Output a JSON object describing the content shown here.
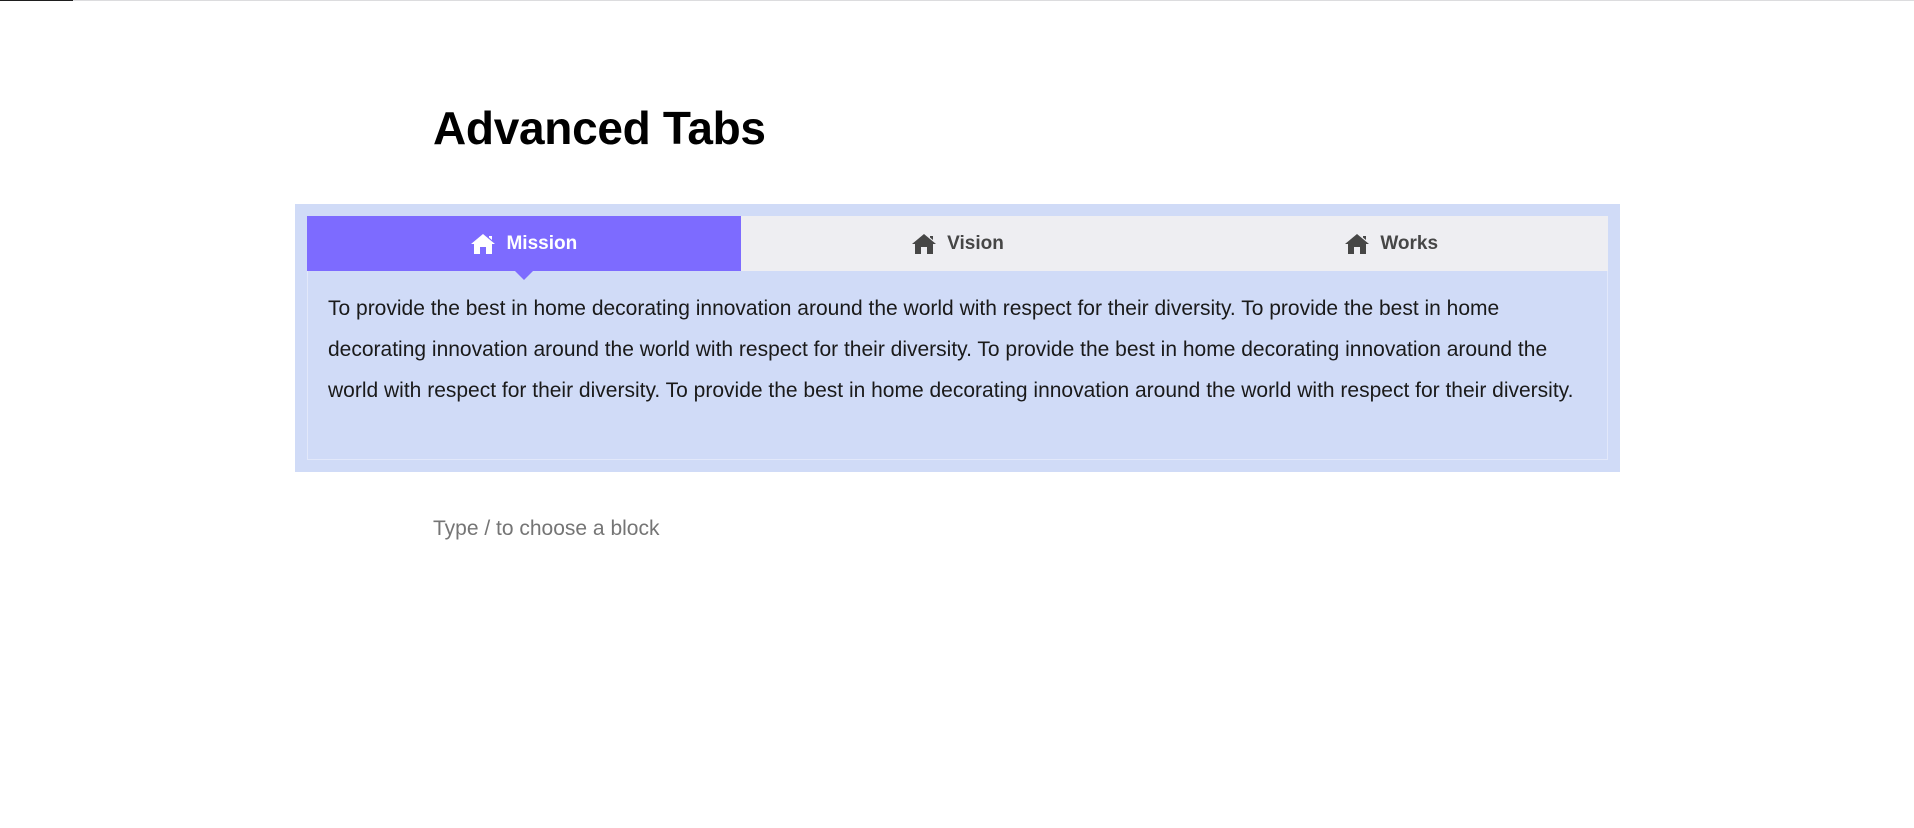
{
  "page": {
    "title": "Advanced Tabs"
  },
  "tabs": {
    "items": [
      {
        "label": "Mission",
        "icon": "home-icon",
        "active": true
      },
      {
        "label": "Vision",
        "icon": "home-icon",
        "active": false
      },
      {
        "label": "Works",
        "icon": "home-icon",
        "active": false
      }
    ],
    "active_content": "To provide the best in home decorating innovation around the world with respect for their diversity. To provide the best in home decorating innovation around the world with respect for their diversity. To provide the best in home decorating innovation around the world with respect for their diversity. To provide the best in home decorating innovation around the world with respect for their diversity."
  },
  "editor": {
    "placeholder": "Type / to choose a block"
  },
  "colors": {
    "active_tab": "#7d6bff",
    "inactive_tab": "#eeeef2",
    "block_background": "#d0dbf7"
  }
}
